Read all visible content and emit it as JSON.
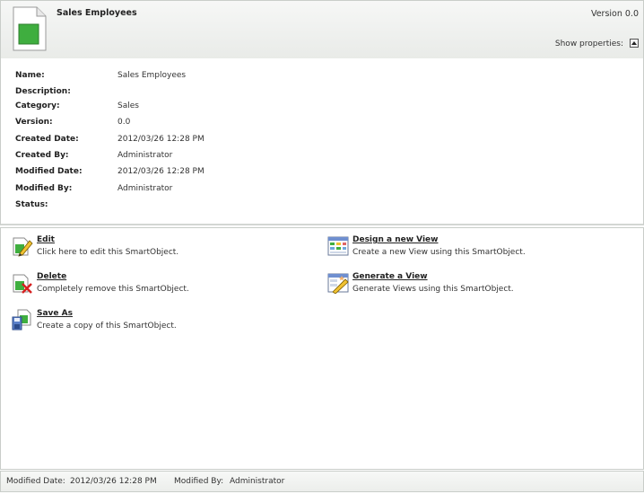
{
  "header": {
    "title": "Sales Employees",
    "version": "Version 0.0",
    "show_properties_label": "Show properties:"
  },
  "properties": [
    {
      "label": "Name:",
      "value": "Sales Employees"
    },
    {
      "label": "Description:",
      "value": ""
    },
    {
      "label": "Category:",
      "value": "Sales"
    },
    {
      "label": "Version:",
      "value": "0.0"
    },
    {
      "label": "Created Date:",
      "value": "2012/03/26 12:28 PM"
    },
    {
      "label": "Created By:",
      "value": "Administrator"
    },
    {
      "label": "Modified Date:",
      "value": "2012/03/26 12:28 PM"
    },
    {
      "label": "Modified By:",
      "value": "Administrator"
    },
    {
      "label": "Status:",
      "value": ""
    }
  ],
  "actions": {
    "edit": {
      "label": "Edit",
      "description": "Click here to edit this SmartObject.",
      "icon": "edit-icon"
    },
    "delete": {
      "label": "Delete",
      "description": "Completely remove this SmartObject.",
      "icon": "delete-icon"
    },
    "save_as": {
      "label": "Save As",
      "description": "Create a copy of this SmartObject.",
      "icon": "save-as-icon"
    },
    "design_view": {
      "label": "Design a new View",
      "description": "Create a new View using this SmartObject.",
      "icon": "design-view-icon"
    },
    "generate_view": {
      "label": "Generate a View",
      "description": "Generate Views using this SmartObject.",
      "icon": "generate-view-icon"
    }
  },
  "footer": {
    "modified_date_label": "Modified Date:",
    "modified_date": "2012/03/26 12:28 PM",
    "modified_by_label": "Modified By:",
    "modified_by": "Administrator"
  },
  "colors": {
    "object_icon_green": "#3fae3f",
    "header_bg": "#eceeeb",
    "border": "#c9cdc9"
  }
}
